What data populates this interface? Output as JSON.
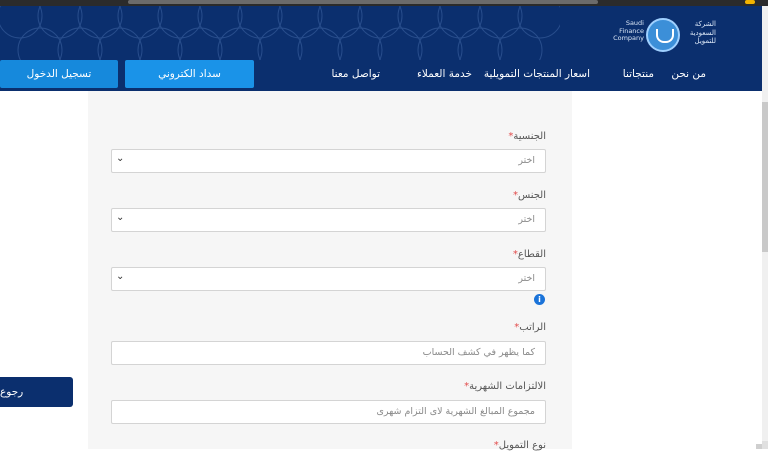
{
  "brand": {
    "name_en_lines": [
      "Saudi",
      "Finance",
      "Company"
    ],
    "name_ar_lines": [
      "الشركة",
      "السعودية",
      "للتمويل"
    ]
  },
  "nav": {
    "items": [
      "من نحن",
      "منتجاتنا",
      "اسعار المنتجات التمويلية",
      "خدمة العملاء",
      "تواصل معنا"
    ],
    "pay_label": "سداد الكتروني",
    "login_label": "تسجيل الدخول"
  },
  "form": {
    "fields": [
      {
        "label": "الجنسية",
        "placeholder": "اختر",
        "type": "select"
      },
      {
        "label": "الجنس",
        "placeholder": "اختر",
        "type": "select"
      },
      {
        "label": "القطاع",
        "placeholder": "اختر",
        "type": "select"
      },
      {
        "label": "الراتب",
        "placeholder": "كما يظهر في كشف الحساب",
        "type": "text"
      },
      {
        "label": "الالتزامات الشهرية",
        "placeholder": "مجموع المبالغ الشهرية لاى التزام شهرى",
        "type": "text"
      },
      {
        "label": "نوع التمويل",
        "placeholder": "",
        "type": "select"
      }
    ],
    "required_marker": "*",
    "info_glyph": "i"
  },
  "back_button": "رجوع",
  "colors": {
    "header": "#0b2f6e",
    "accent": "#1a93e8",
    "panel": "#f6f6f6",
    "required": "#e24b4b"
  }
}
